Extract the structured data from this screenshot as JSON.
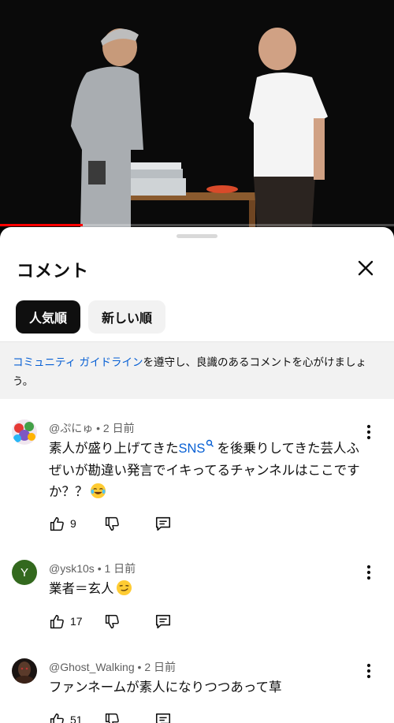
{
  "video": {
    "progress_fraction": 0.21
  },
  "sheet": {
    "title": "コメント",
    "chips": [
      {
        "label": "人気順",
        "selected": true
      },
      {
        "label": "新しい順",
        "selected": false
      }
    ],
    "notice": {
      "link_text": "コミュニティ ガイドライン",
      "rest_text": "を遵守し、良識のあるコメントを心がけましょう。"
    }
  },
  "comments": [
    {
      "author": "@ぷにゅ",
      "time": "2 日前",
      "text_before": "素人が盛り上げてきた",
      "link": "SNS",
      "text_after": "を後乗りしてきた芸人ふぜいが勘違い発言でイキってるチャンネルはここですか？？",
      "emoji": "tears-of-joy-emoji",
      "likes": "9"
    },
    {
      "author": "@ysk10s",
      "avatar_letter": "Y",
      "time": "1 日前",
      "text": "業者＝玄人",
      "emoji": "smirk-emoji",
      "likes": "17"
    },
    {
      "author": "@Ghost_Walking",
      "time": "2 日前",
      "text": "ファンネームが素人になりつつあって草",
      "likes": "51"
    }
  ],
  "colors": {
    "link": "#065fd4",
    "progress": "#ff0000",
    "avatar_y": "#33691e"
  }
}
